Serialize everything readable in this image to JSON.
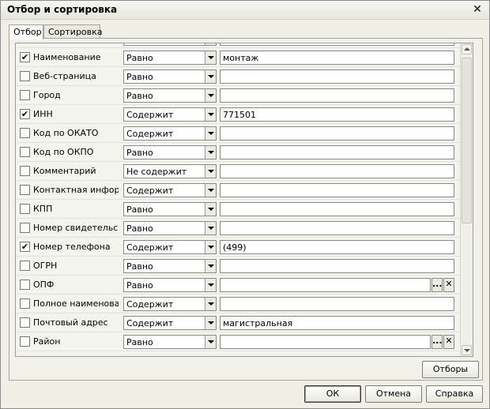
{
  "window": {
    "title": "Отбор и сортировка"
  },
  "tabs": [
    {
      "label": "Отбор"
    },
    {
      "label": "Сортировка"
    }
  ],
  "rows": [
    {
      "label": "Наименование",
      "checked": true,
      "op": "Равно",
      "value": "монтаж",
      "buttons": false
    },
    {
      "label": "Веб-страница",
      "checked": false,
      "op": "Равно",
      "value": "",
      "buttons": false
    },
    {
      "label": "Город",
      "checked": false,
      "op": "Равно",
      "value": "",
      "buttons": false
    },
    {
      "label": "ИНН",
      "checked": true,
      "op": "Содержит",
      "value": "771501",
      "buttons": false
    },
    {
      "label": "Код по ОКАТО",
      "checked": false,
      "op": "Содержит",
      "value": "",
      "buttons": false
    },
    {
      "label": "Код по ОКПО",
      "checked": false,
      "op": "Равно",
      "value": "",
      "buttons": false
    },
    {
      "label": "Комментарий",
      "checked": false,
      "op": "Не содержит",
      "value": "",
      "buttons": false
    },
    {
      "label": "Контактная инфор...",
      "checked": false,
      "op": "Содержит",
      "value": "",
      "buttons": false
    },
    {
      "label": "КПП",
      "checked": false,
      "op": "Равно",
      "value": "",
      "buttons": false
    },
    {
      "label": "Номер свидетельс...",
      "checked": false,
      "op": "Равно",
      "value": "",
      "buttons": false
    },
    {
      "label": "Номер телефона",
      "checked": true,
      "op": "Содержит",
      "value": "(499)",
      "buttons": false
    },
    {
      "label": "ОГРН",
      "checked": false,
      "op": "Равно",
      "value": "",
      "buttons": false
    },
    {
      "label": "ОПФ",
      "checked": false,
      "op": "Равно",
      "value": "",
      "buttons": true
    },
    {
      "label": "Полное наименова...",
      "checked": false,
      "op": "Содержит",
      "value": "",
      "buttons": false
    },
    {
      "label": "Почтовый адрес",
      "checked": false,
      "op": "Содержит",
      "value": "магистральная",
      "buttons": false
    },
    {
      "label": "Район",
      "checked": false,
      "op": "Равно",
      "value": "",
      "buttons": true
    }
  ],
  "icons": {
    "check": "check-icon",
    "close": "close-icon",
    "select": "ellipsis-icon",
    "clear": "clear-x-icon",
    "dropdown": "dropdown-arrow-icon"
  },
  "glyphs": {
    "check": "✔",
    "close": "✕",
    "select": "...",
    "clear": "✕"
  },
  "buttons": {
    "filters": "Отборы",
    "ok": "ОК",
    "cancel": "Отмена",
    "help": "Справка"
  }
}
